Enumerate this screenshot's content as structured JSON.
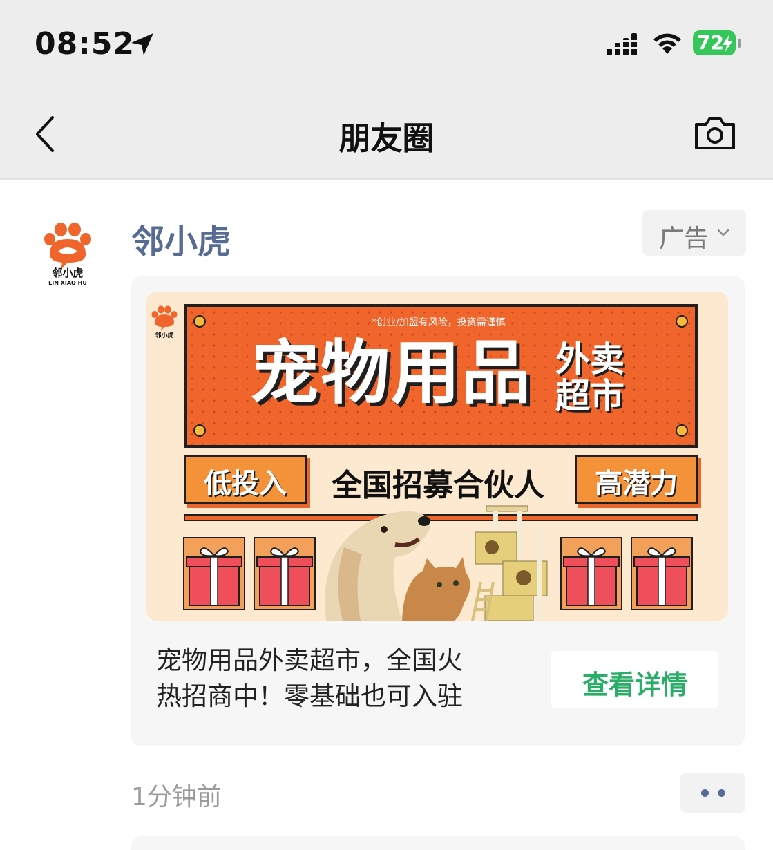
{
  "status_bar": {
    "time": "08:52",
    "battery_level": "72",
    "icons": [
      "location-arrow-icon",
      "cellular-signal-icon",
      "wifi-icon",
      "battery-charging-icon"
    ]
  },
  "nav": {
    "title": "朋友圈",
    "back_icon": "chevron-left-icon",
    "camera_icon": "camera-icon"
  },
  "post": {
    "author": "邻小虎",
    "avatar": {
      "brand": "邻小虎",
      "brand_en": "LIN XIAO HU"
    },
    "ad_tag": "广告",
    "banner": {
      "risk_note": "*创业/加盟有风险，投资需谨慎",
      "headline": "宠物用品",
      "headline_side_1": "外卖",
      "headline_side_2": "超市",
      "left_tag": "低投入",
      "center_text": "全国招募合伙人",
      "right_tag": "高潜力",
      "logo_text": "邻小虎"
    },
    "caption_line1": "宠物用品外卖超市，全国火",
    "caption_line2": "热招商中！零基础也可入驻",
    "cta": "查看详情",
    "timestamp": "1分钟前",
    "more_icon": "more-dots-icon"
  },
  "colors": {
    "link_blue": "#576b95",
    "cta_green": "#2aae67",
    "banner_orange": "#f0652b",
    "brand_orange": "#f0652b",
    "battery_green": "#35c759"
  }
}
